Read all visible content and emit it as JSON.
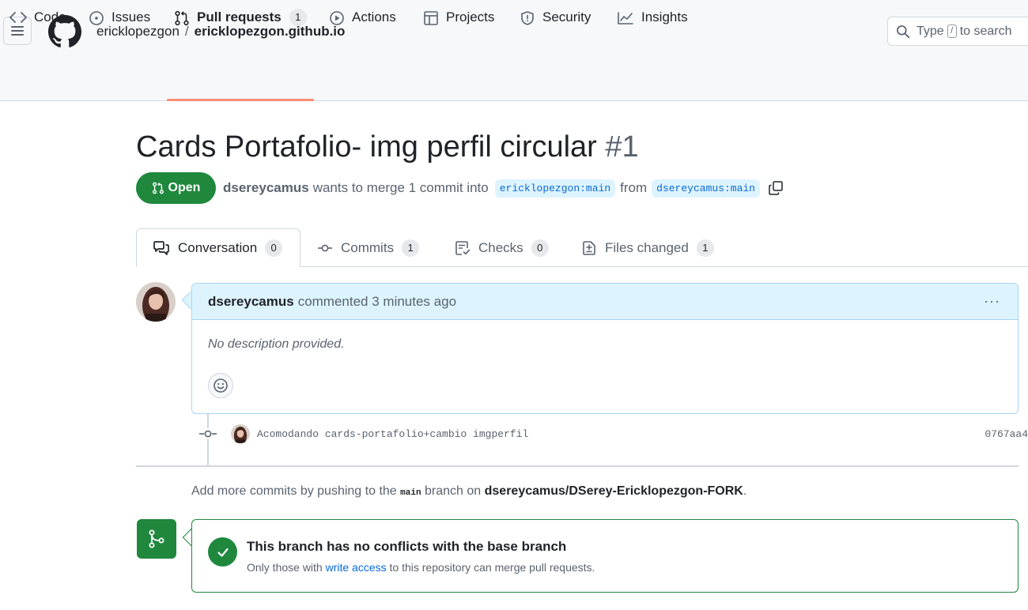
{
  "header": {
    "owner": "ericklopezgon",
    "separator": "/",
    "repo": "ericklopezgon.github.io",
    "search_prefix": "Type",
    "search_key": "/",
    "search_suffix": "to search"
  },
  "nav": {
    "code": "Code",
    "issues": "Issues",
    "pull_requests": "Pull requests",
    "pull_requests_count": "1",
    "actions": "Actions",
    "projects": "Projects",
    "security": "Security",
    "insights": "Insights"
  },
  "pr": {
    "title": "Cards Portafolio- img perfil circular",
    "number": "#1",
    "state": "Open",
    "author": "dsereycamus",
    "merge_text": "wants to merge 1 commit into",
    "base_branch": "ericklopezgon:main",
    "from_text": "from",
    "head_branch": "dsereycamus:main"
  },
  "tabs": {
    "conversation": "Conversation",
    "conversation_count": "0",
    "commits": "Commits",
    "commits_count": "1",
    "checks": "Checks",
    "checks_count": "0",
    "files": "Files changed",
    "files_count": "1"
  },
  "comment": {
    "author": "dsereycamus",
    "action": "commented 3 minutes ago",
    "kebab": "···",
    "body": "No description provided."
  },
  "commit": {
    "message": "Acomodando cards-portafolio+cambio imgperfil",
    "sha": "0767aa4"
  },
  "push_hint": {
    "prefix": "Add more commits by pushing to the",
    "branch": "main",
    "middle": "branch on",
    "repo": "dsereycamus/DSerey-Ericklopezgon-FORK",
    "suffix": "."
  },
  "merge": {
    "title": "This branch has no conflicts with the base branch",
    "sub_prefix": "Only those with",
    "sub_link": "write access",
    "sub_suffix": "to this repository can merge pull requests."
  },
  "colors": {
    "accent_green": "#1f883d",
    "link_blue": "#0969da",
    "nav_underline": "#fd8c73",
    "comment_header": "#ddf4ff"
  }
}
